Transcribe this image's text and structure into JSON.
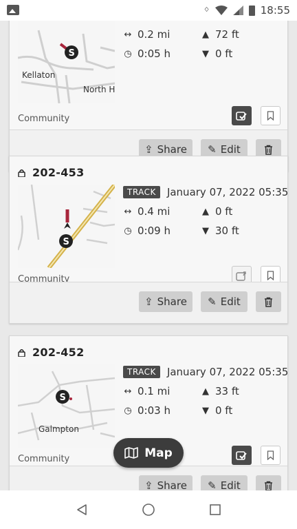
{
  "status_bar": {
    "time": "18:55",
    "icons": [
      "image-icon",
      "bluetooth-icon",
      "wifi-icon",
      "signal-icon",
      "battery-icon"
    ]
  },
  "cards": [
    {
      "title": "",
      "source": "Community",
      "distance": "0.2 mi",
      "duration": "0:05 h",
      "ascent": "72 ft",
      "descent": "0 ft",
      "map_labels": [
        "Kellaton",
        "North Ha"
      ],
      "sync_state": "synced",
      "actions": {
        "share": "Share",
        "edit": "Edit"
      }
    },
    {
      "title": "202-453",
      "tag": "TRACK",
      "date": "January 07, 2022 05:35",
      "source": "Community",
      "distance": "0.4 mi",
      "duration": "0:09 h",
      "ascent": "0 ft",
      "descent": "30 ft",
      "activity": "hiking",
      "sync_state": "not-synced",
      "actions": {
        "share": "Share",
        "edit": "Edit"
      }
    },
    {
      "title": "202-452",
      "tag": "TRACK",
      "date": "January 07, 2022 05:35",
      "source": "Community",
      "distance": "0.1 mi",
      "duration": "0:03 h",
      "ascent": "33 ft",
      "descent": "0 ft",
      "activity": "hiking",
      "map_labels": [
        "Galmpton"
      ],
      "sync_state": "synced",
      "actions": {
        "share": "Share",
        "edit": "Edit"
      }
    }
  ],
  "map_button": {
    "label": "Map"
  },
  "colors": {
    "activity_badge": "#a8263c",
    "tag_bg": "#4a4a4a",
    "fab_bg": "#3c3c3c",
    "action_bg": "#cfcfcf"
  }
}
